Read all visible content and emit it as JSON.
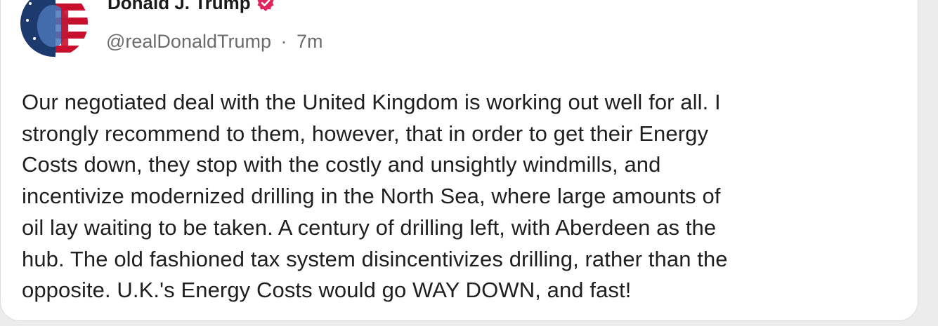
{
  "post": {
    "author": {
      "display_name": "Donald J. Trump",
      "handle": "@realDonaldTrump",
      "separator": "·",
      "time": "7m",
      "verified_icon": "verified-badge-icon",
      "verified_color": "#e0245e"
    },
    "lines": [
      "Our negotiated deal with the United Kingdom is working out well for all. I",
      "strongly recommend to them, however, that in order to get their Energy",
      "Costs down, they stop with the costly and unsightly windmills, and",
      "incentivize modernized drilling in the North Sea, where large amounts of",
      "oil lay waiting to be taken. A century of drilling left, with Aberdeen as the",
      "hub. The old fashioned tax system disincentivizes drilling, rather than the",
      "opposite. U.K.'s Energy Costs would go WAY DOWN, and fast!"
    ]
  }
}
